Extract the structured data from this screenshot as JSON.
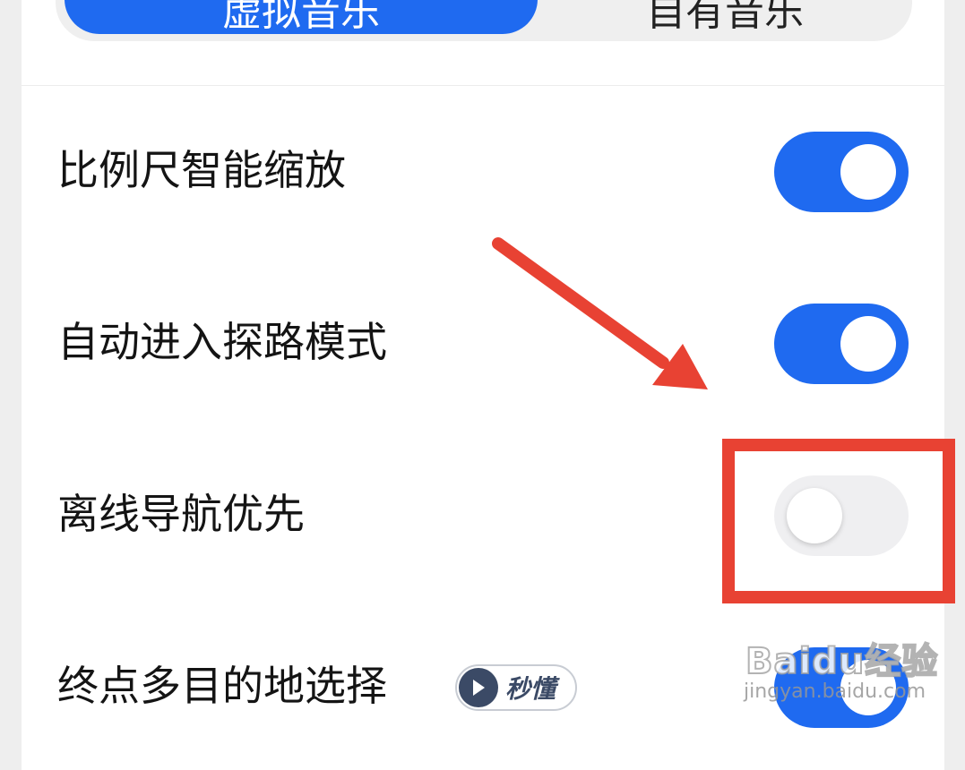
{
  "segmented": {
    "tabs": [
      {
        "label": "虚拟音乐",
        "active": true
      },
      {
        "label": "自有音乐",
        "active": false
      }
    ]
  },
  "settings": [
    {
      "label": "比例尺智能缩放",
      "enabled": true
    },
    {
      "label": "自动进入探路模式",
      "enabled": true
    },
    {
      "label": "离线导航优先",
      "enabled": false
    },
    {
      "label": "终点多目的地选择",
      "enabled": true,
      "badge": "秒懂"
    }
  ],
  "watermark": {
    "logo": "Baidu经验",
    "url": "jingyan.baidu.com"
  },
  "colors": {
    "accent": "#1f6af0",
    "annotation": "#e84233",
    "toggle_off": "#efeff1"
  }
}
